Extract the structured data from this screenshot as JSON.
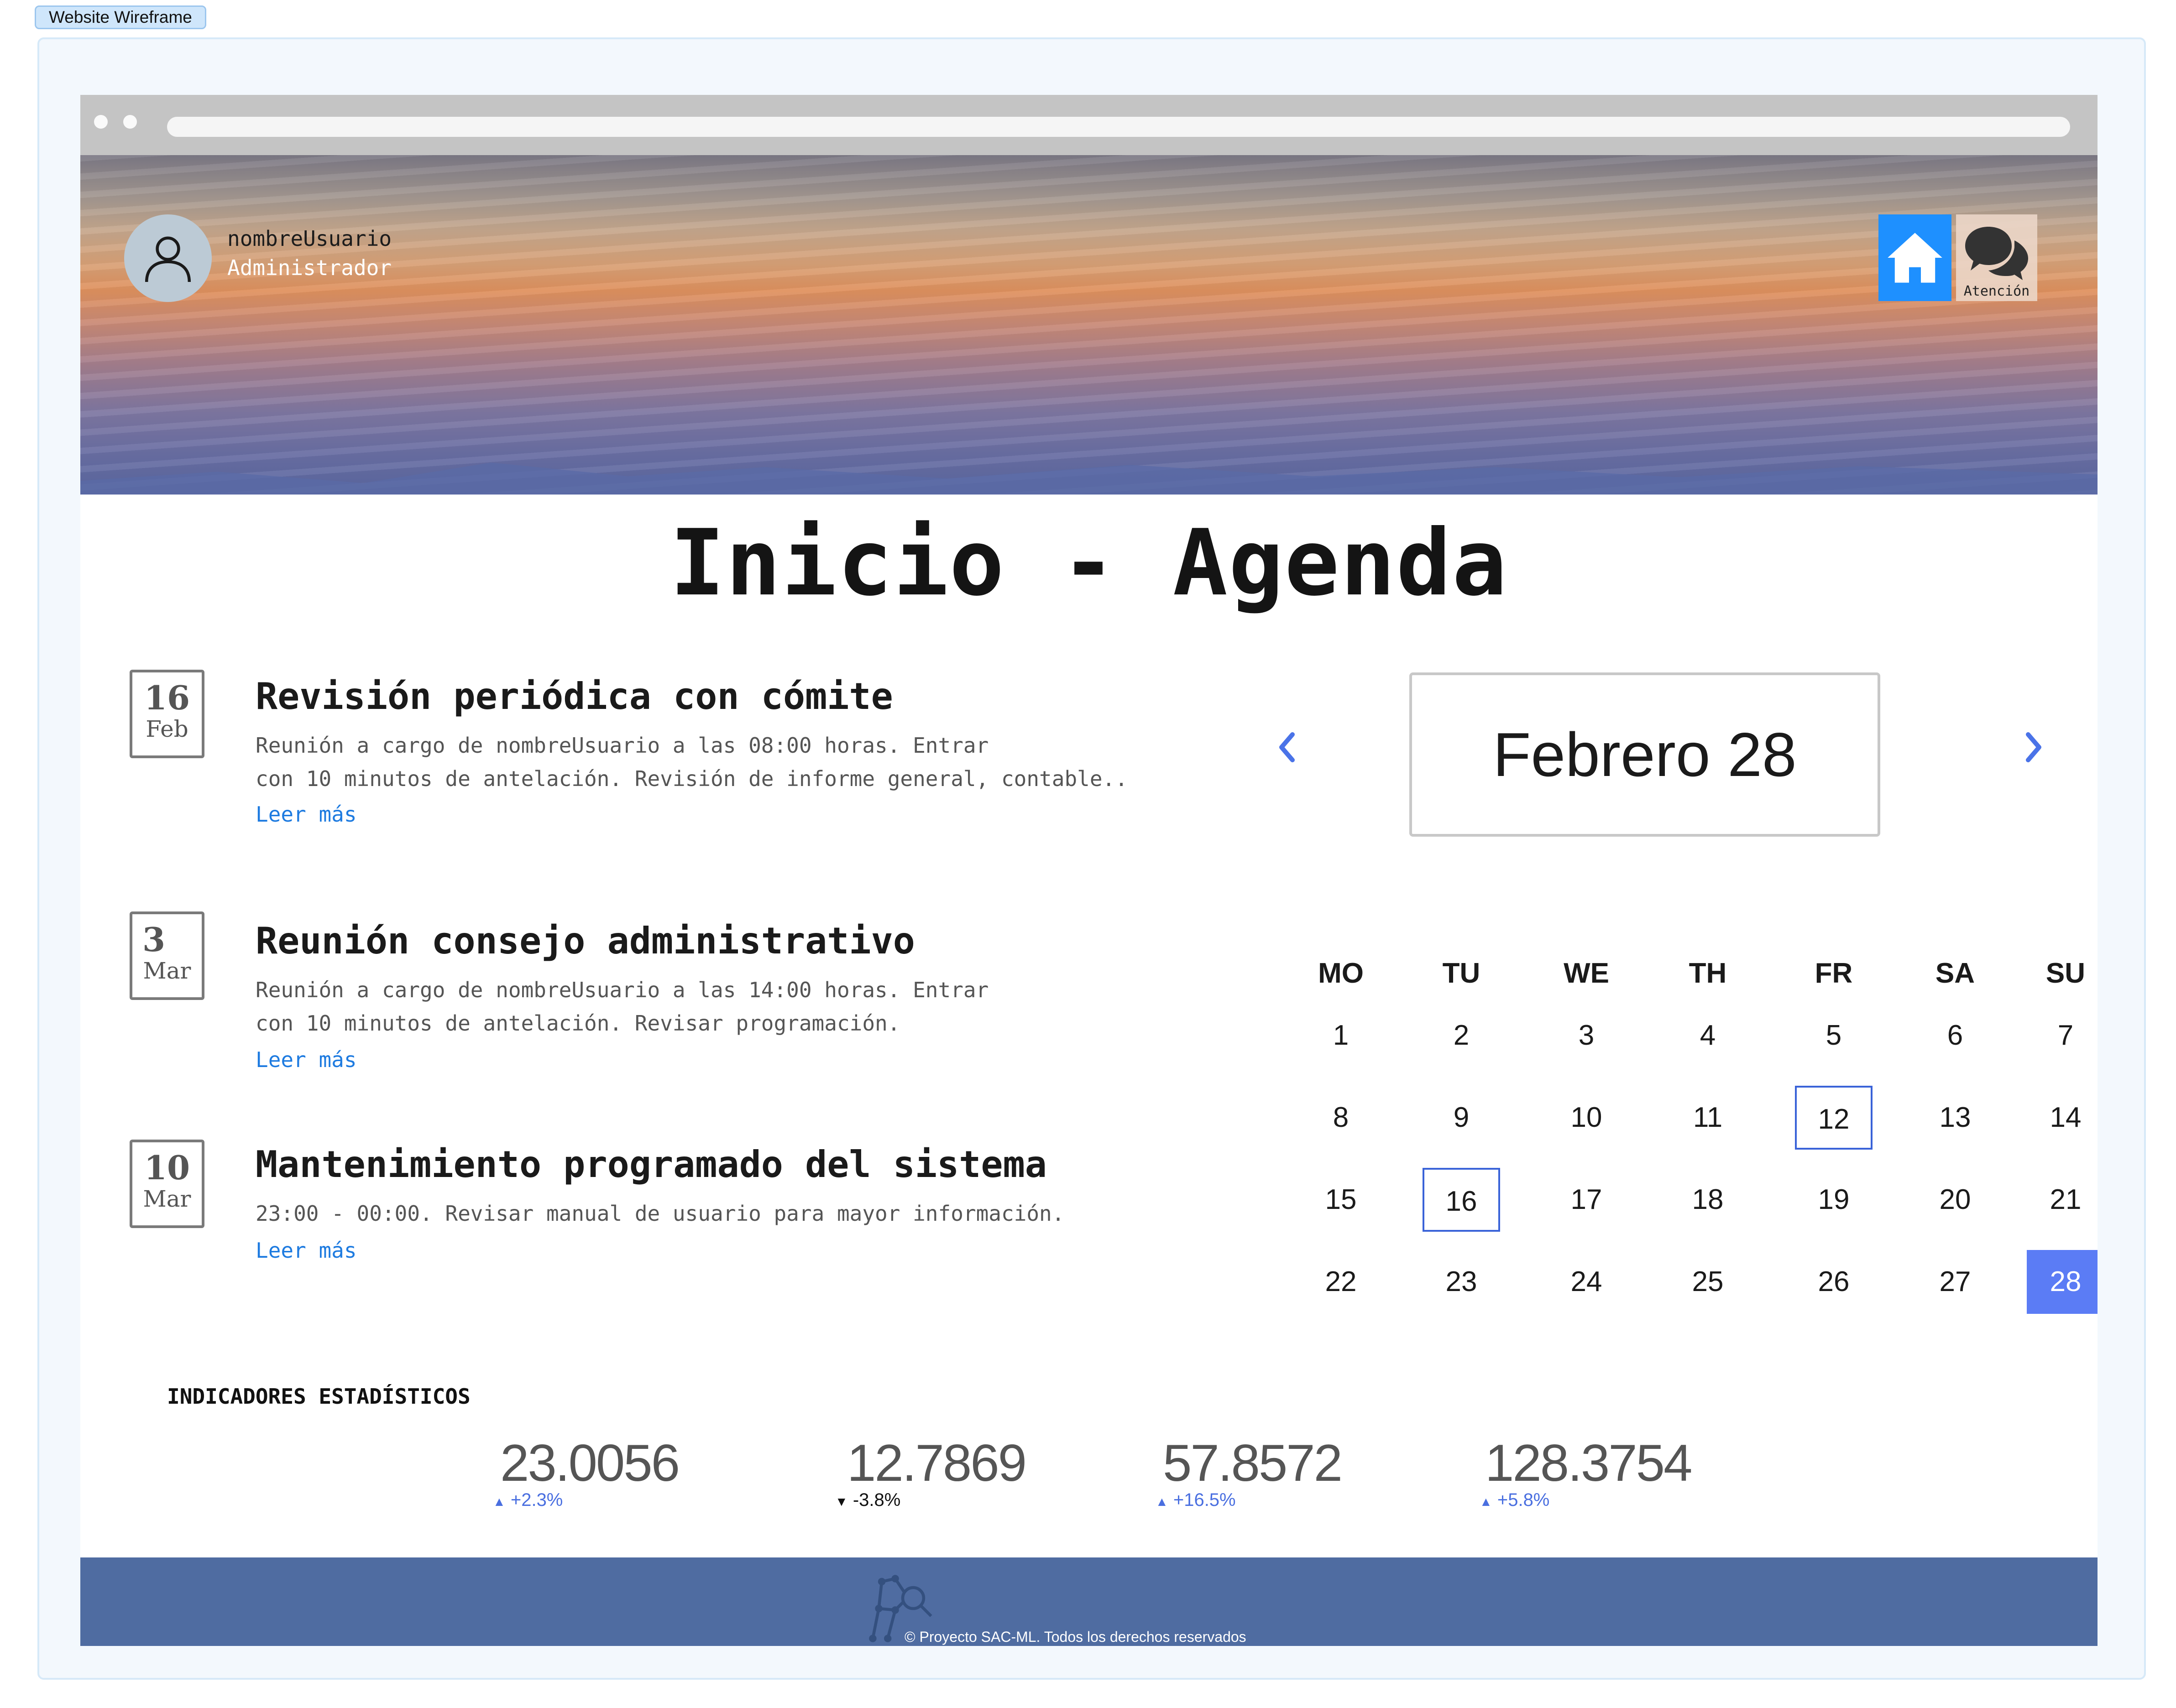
{
  "wireframe_tag": "Website Wireframe",
  "header": {
    "username": "nombreUsuario",
    "role": "Administrador",
    "chat_label": "Atención"
  },
  "page": {
    "title": "Inicio - Agenda"
  },
  "events": [
    {
      "day": "16",
      "month": "Feb",
      "title": "Revisión periódica con cómite",
      "desc_lines": [
        "Reunión a cargo de nombreUsuario a las 08:00 horas. Entrar",
        "con 10 minutos de antelación. Revisión de informe general, contable.."
      ],
      "more": "Leer más"
    },
    {
      "day": "3",
      "month": "Mar",
      "title": "Reunión consejo administrativo",
      "desc_lines": [
        "Reunión a cargo de nombreUsuario a las 14:00 horas. Entrar",
        "con 10 minutos de antelación. Revisar programación."
      ],
      "more": "Leer más"
    },
    {
      "day": "10",
      "month": "Mar",
      "title": "Mantenimiento programado del sistema",
      "desc_lines": [
        "23:00 - 00:00. Revisar manual de usuario para mayor información."
      ],
      "more": "Leer más"
    }
  ],
  "calendar": {
    "month_label": "Febrero 28",
    "weekdays": [
      "MO",
      "TU",
      "WE",
      "TH",
      "FR",
      "SA",
      "SU"
    ],
    "weeks": [
      [
        "1",
        "2",
        "3",
        "4",
        "5",
        "6",
        "7"
      ],
      [
        "8",
        "9",
        "10",
        "11",
        "12",
        "13",
        "14"
      ],
      [
        "15",
        "16",
        "17",
        "18",
        "19",
        "20",
        "21"
      ],
      [
        "22",
        "23",
        "24",
        "25",
        "26",
        "27",
        "28"
      ]
    ],
    "marked_days": [
      "12",
      "16"
    ],
    "selected_day": "28"
  },
  "stats": {
    "heading": "INDICADORES ESTADÍSTICOS",
    "items": [
      {
        "value": "23.0056",
        "change": "+2.3%",
        "direction": "up"
      },
      {
        "value": "12.7869",
        "change": "-3.8%",
        "direction": "down"
      },
      {
        "value": "57.8572",
        "change": "+16.5%",
        "direction": "up"
      },
      {
        "value": "128.3754",
        "change": "+5.8%",
        "direction": "up"
      }
    ]
  },
  "footer": {
    "copyright": "© Proyecto SAC-ML. Todos los derechos reservados"
  },
  "colors": {
    "accent": "#5b7cf5",
    "home_button": "#1e90ff",
    "link": "#1e7be0",
    "footer_bg": "#4f6ca1",
    "up": "#4a6fe0",
    "down": "#111111"
  },
  "icons": {
    "avatar": "user-icon",
    "home": "home-icon",
    "chat": "chat-bubbles-icon",
    "prev": "chevron-left-icon",
    "next": "chevron-right-icon",
    "footer_logo": "network-search-logo-icon"
  }
}
